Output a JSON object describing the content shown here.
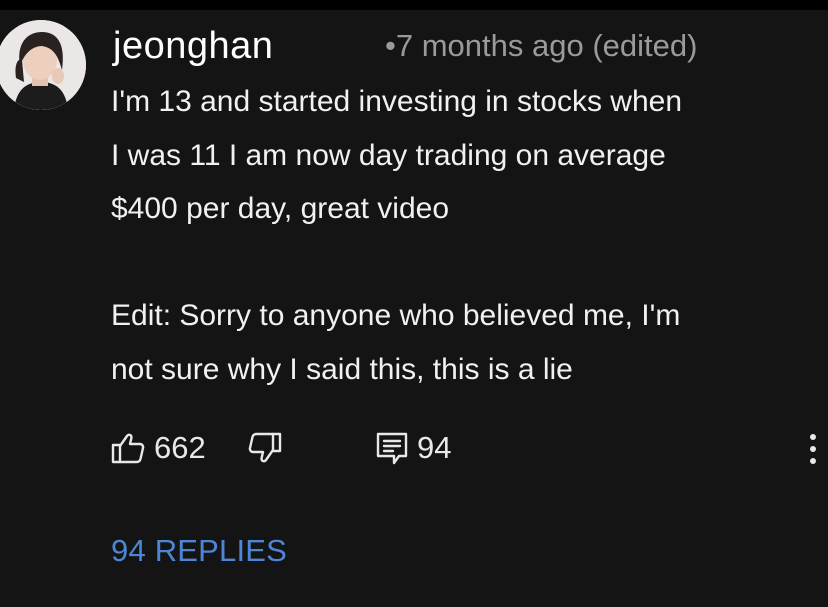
{
  "comment": {
    "username": "jeonghan",
    "meta": "•7 months ago (edited)",
    "body_lines": [
      "I'm 13 and started investing in stocks when",
      "I was 11 I am now day trading on average",
      "$400 per day, great video"
    ],
    "edit_lines": [
      "Edit: Sorry to anyone who believed me, I'm",
      "not sure why I said this, this is a lie"
    ],
    "likes": "662",
    "reply_count": "94",
    "replies_link": "94 REPLIES"
  },
  "icons": {
    "like": "thumbs-up-icon",
    "dislike": "thumbs-down-icon",
    "reply": "reply-comment-icon",
    "more": "more-vertical-icon"
  },
  "colors": {
    "background": "#141414",
    "text": "#f1f1f1",
    "meta_text": "#9a9a9a",
    "link_blue": "#4d86d6"
  }
}
